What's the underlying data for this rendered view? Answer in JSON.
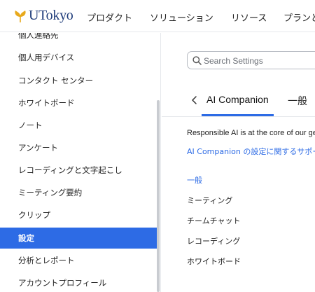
{
  "header": {
    "logo_text": "UTokyo",
    "nav": [
      "プロダクト",
      "ソリューション",
      "リソース",
      "プランと"
    ]
  },
  "sidebar": {
    "items": [
      {
        "label": "個人連絡先"
      },
      {
        "label": "個人用デバイス"
      },
      {
        "label": "コンタクト センター"
      },
      {
        "label": "ホワイトボード"
      },
      {
        "label": "ノート"
      },
      {
        "label": "アンケート"
      },
      {
        "label": "レコーディングと文字起こし"
      },
      {
        "label": "ミーティング要約"
      },
      {
        "label": "クリップ"
      },
      {
        "label": "設定",
        "active": true
      },
      {
        "label": "分析とレポート"
      },
      {
        "label": "アカウントプロフィール"
      }
    ]
  },
  "search": {
    "placeholder": "Search Settings"
  },
  "tabs": [
    {
      "label": "AI Companion",
      "active": true
    },
    {
      "label": "一般"
    }
  ],
  "main": {
    "intro_text": "Responsible AI is at the core of our ge",
    "intro_link": "AI Companion の設定に関するサポー",
    "categories": [
      {
        "label": "一般",
        "active": true
      },
      {
        "label": "ミーティング"
      },
      {
        "label": "チームチャット"
      },
      {
        "label": "レコーディング"
      },
      {
        "label": "ホワイトボード"
      }
    ]
  },
  "colors": {
    "accent": "#2d6be5",
    "brand": "#1f3c7a",
    "logo_gold": "#e8a91c"
  }
}
